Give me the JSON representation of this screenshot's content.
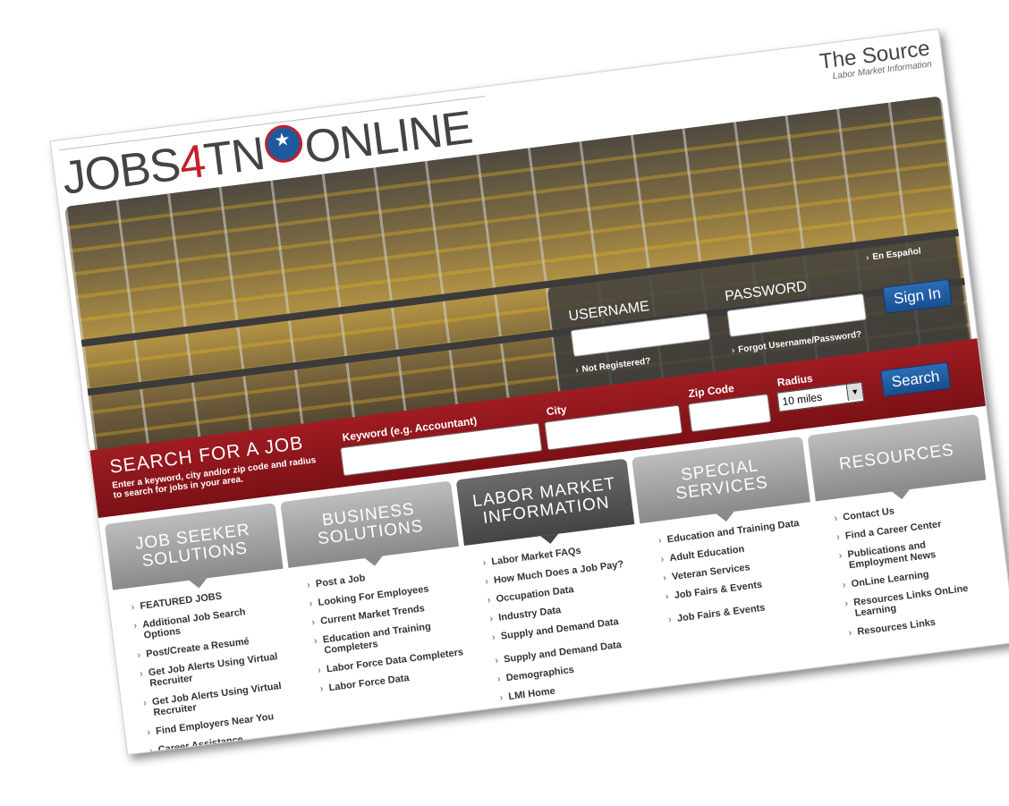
{
  "header": {
    "logo_part1": "JOBS",
    "logo_part2": "4",
    "logo_part3": "TN",
    "logo_part4": "ONLINE",
    "source_title": "The Source",
    "source_subtitle": "Labor Market Information"
  },
  "login": {
    "spanish_link": "En Español",
    "username_label": "USERNAME",
    "password_label": "PASSWORD",
    "signin_label": "Sign In",
    "not_registered": "Not Registered?",
    "forgot": "Forgot Username/Password?"
  },
  "search": {
    "title": "SEARCH FOR A JOB",
    "subtitle": "Enter a keyword, city and/or zip code and radius to search for jobs in your area.",
    "keyword_label": "Keyword (e.g. Accountant)",
    "city_label": "City",
    "zip_label": "Zip Code",
    "radius_label": "Radius",
    "radius_value": "10 miles",
    "search_label": "Search"
  },
  "columns": [
    {
      "title_line1": "JOB SEEKER",
      "title_line2": "SOLUTIONS",
      "items": [
        "FEATURED JOBS",
        "Additional Job Search Options",
        "Post/Create a Resumé",
        "Get Job Alerts Using Virtual Recruiter",
        "Get Job Alerts Using Virtual Recruiter",
        "Find Employers Near You",
        "Career Assistance"
      ]
    },
    {
      "title_line1": "BUSINESS",
      "title_line2": "SOLUTIONS",
      "items": [
        "Post a Job",
        "Looking For Employees",
        "Current Market Trends",
        "Education and Training Completers",
        "Labor Force Data Completers",
        "Labor Force Data"
      ]
    },
    {
      "title_line1": "LABOR MARKET",
      "title_line2": "INFORMATION",
      "items": [
        "Labor Market FAQs",
        "How Much Does a Job Pay?",
        "Occupation Data",
        "Industry Data",
        "Supply and Demand Data",
        "Supply and Demand Data",
        "Demographics",
        "LMI Home"
      ]
    },
    {
      "title_line1": "SPECIAL",
      "title_line2": "SERVICES",
      "items": [
        "Education and Training Data",
        "Adult Education",
        "Veteran Services",
        "Job Fairs & Events",
        "Job Fairs & Events"
      ]
    },
    {
      "title_line1": "RESOURCES",
      "title_line2": "",
      "items": [
        "Contact Us",
        "Find a Career Center",
        "Publications and Employment News",
        "OnLine Learning",
        "Resources Links OnLine Learning",
        "Resources Links"
      ]
    }
  ]
}
